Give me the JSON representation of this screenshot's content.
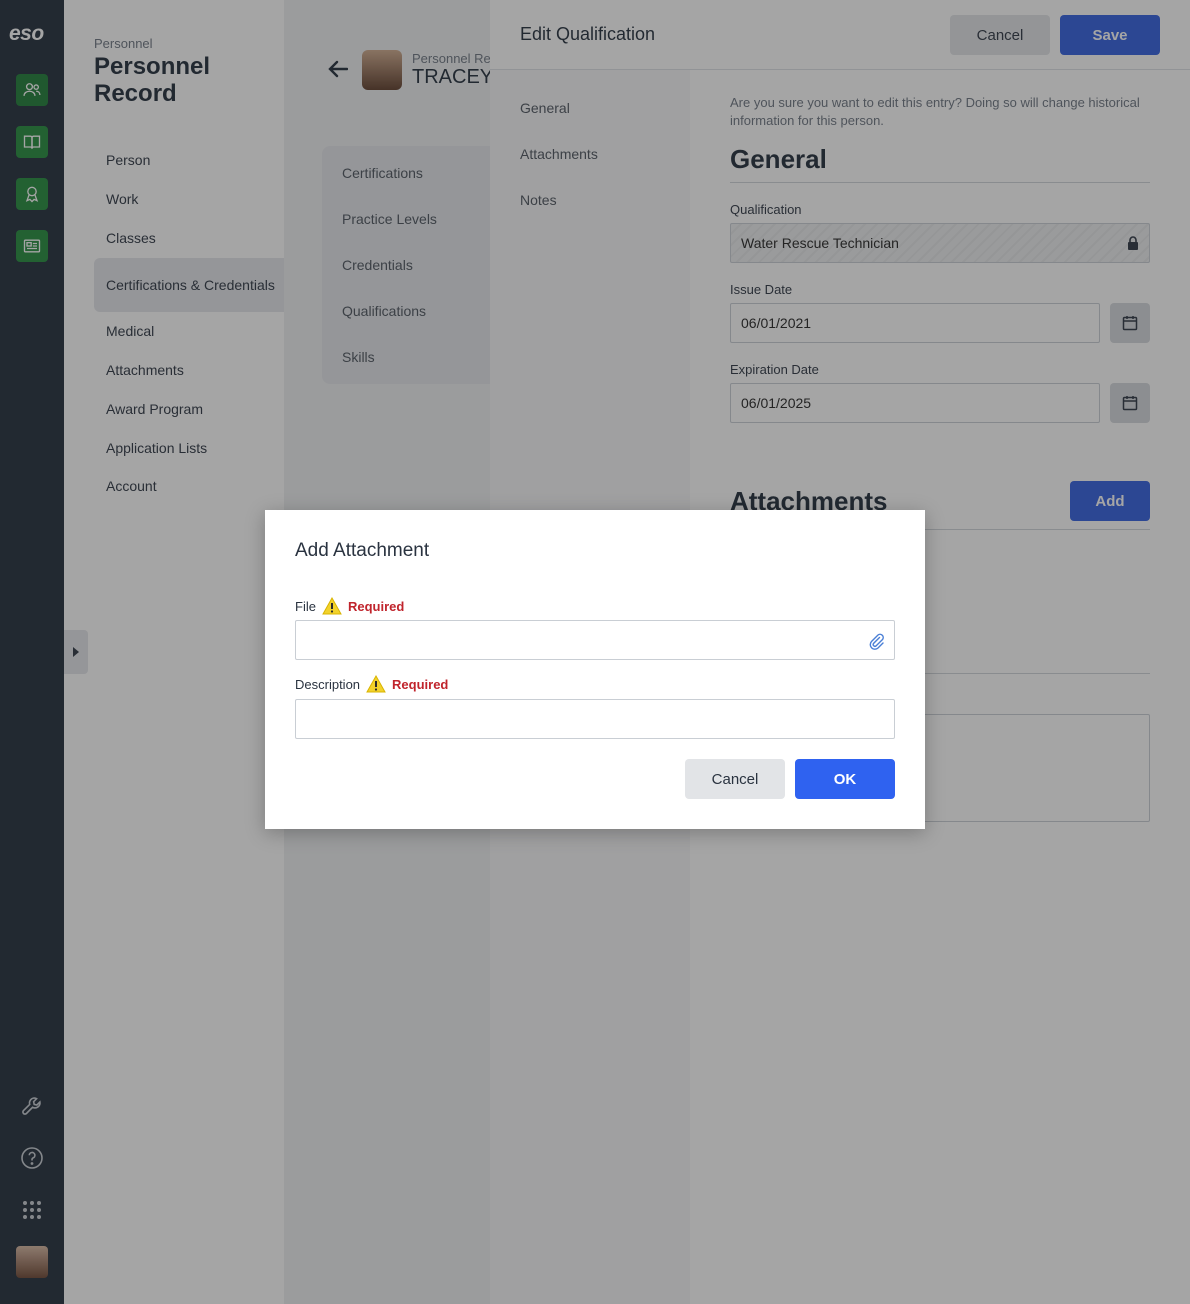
{
  "rail": {
    "logo": "eso",
    "nav_icons": [
      "personnel-icon",
      "book-icon",
      "award-icon",
      "news-icon"
    ],
    "bottom_icons": [
      "wrench-icon",
      "help-icon",
      "apps-grid-icon"
    ]
  },
  "personnel_nav": {
    "crumb": "Personnel",
    "title": "Personnel Record",
    "items": [
      "Person",
      "Work",
      "Classes",
      "Certifications & Credentials",
      "Medical",
      "Attachments",
      "Award Program",
      "Application Lists",
      "Account"
    ],
    "active_index": 3
  },
  "person_header": {
    "subtitle": "Personnel Rec",
    "name": "TRACEY"
  },
  "subnav": {
    "items": [
      "Certifications",
      "Practice Levels",
      "Credentials",
      "Qualifications",
      "Skills"
    ]
  },
  "edit_panel": {
    "title": "Edit Qualification",
    "cancel_label": "Cancel",
    "save_label": "Save",
    "nav": [
      "General",
      "Attachments",
      "Notes"
    ],
    "warning": "Are you sure you want to edit this entry? Doing so will change historical information for this person.",
    "general_heading": "General",
    "qualification_label": "Qualification",
    "qualification_value": "Water Rescue Technician",
    "issue_date_label": "Issue Date",
    "issue_date_value": "06/01/2021",
    "expiration_date_label": "Expiration Date",
    "expiration_date_value": "06/01/2025",
    "attachments_heading": "Attachments",
    "add_label": "Add"
  },
  "modal": {
    "title": "Add Attachment",
    "file_label": "File",
    "file_required": "Required",
    "description_label": "Description",
    "description_required": "Required",
    "cancel_label": "Cancel",
    "ok_label": "OK"
  },
  "colors": {
    "rail": "#1e2a38",
    "rail_accent": "#1f8a3a",
    "primary": "#2f5de0",
    "required": "#c0242c"
  }
}
